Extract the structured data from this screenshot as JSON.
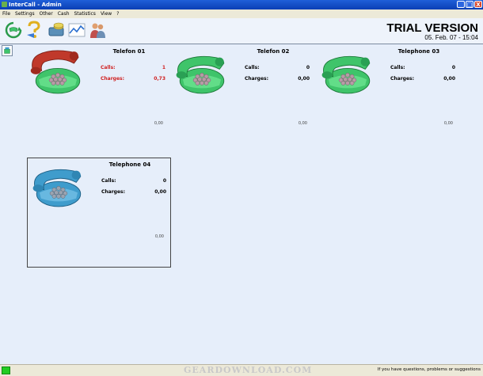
{
  "window": {
    "title": "InterCall - Admin",
    "minimize_label": "_",
    "maximize_label": "□",
    "close_label": "X"
  },
  "menu": [
    "File",
    "Settings",
    "Other",
    "Cash",
    "Statistics",
    "View",
    "?"
  ],
  "toolbar": {
    "icons": [
      "phone-refresh-icon",
      "help-icon",
      "cash-icon",
      "statistics-chart-icon",
      "users-icon"
    ]
  },
  "header": {
    "trial": "TRIAL VERSION",
    "datetime": "05. Feb. 07 - 15:04"
  },
  "phones": [
    {
      "name": "Telefon 01",
      "calls_label": "Calls:",
      "calls": "1",
      "charges_label": "Charges:",
      "charges": "0,73",
      "bottom": "0,00",
      "state": "off-hook",
      "highlight": "#d02020"
    },
    {
      "name": "Telefon 02",
      "calls_label": "Calls:",
      "calls": "0",
      "charges_label": "Charges:",
      "charges": "0,00",
      "bottom": "0,00",
      "state": "idle"
    },
    {
      "name": "Telephone 03",
      "calls_label": "Calls:",
      "calls": "0",
      "charges_label": "Charges:",
      "charges": "0,00",
      "bottom": "0,00",
      "state": "idle"
    },
    {
      "name": "Telephone 04",
      "calls_label": "Calls:",
      "calls": "0",
      "charges_label": "Charges:",
      "charges": "0,00",
      "bottom": "0,00",
      "state": "selected"
    }
  ],
  "colors": {
    "phone_green": "#3fc46a",
    "handset_red": "#c0392b",
    "phone_blue": "#3f9ccc",
    "titlebar": "#0a3fb5",
    "background": "#e6eefa"
  },
  "status": {
    "watermark": "GEARDOWNLOAD.COM",
    "message": "If you have questions, problems or suggestions"
  }
}
